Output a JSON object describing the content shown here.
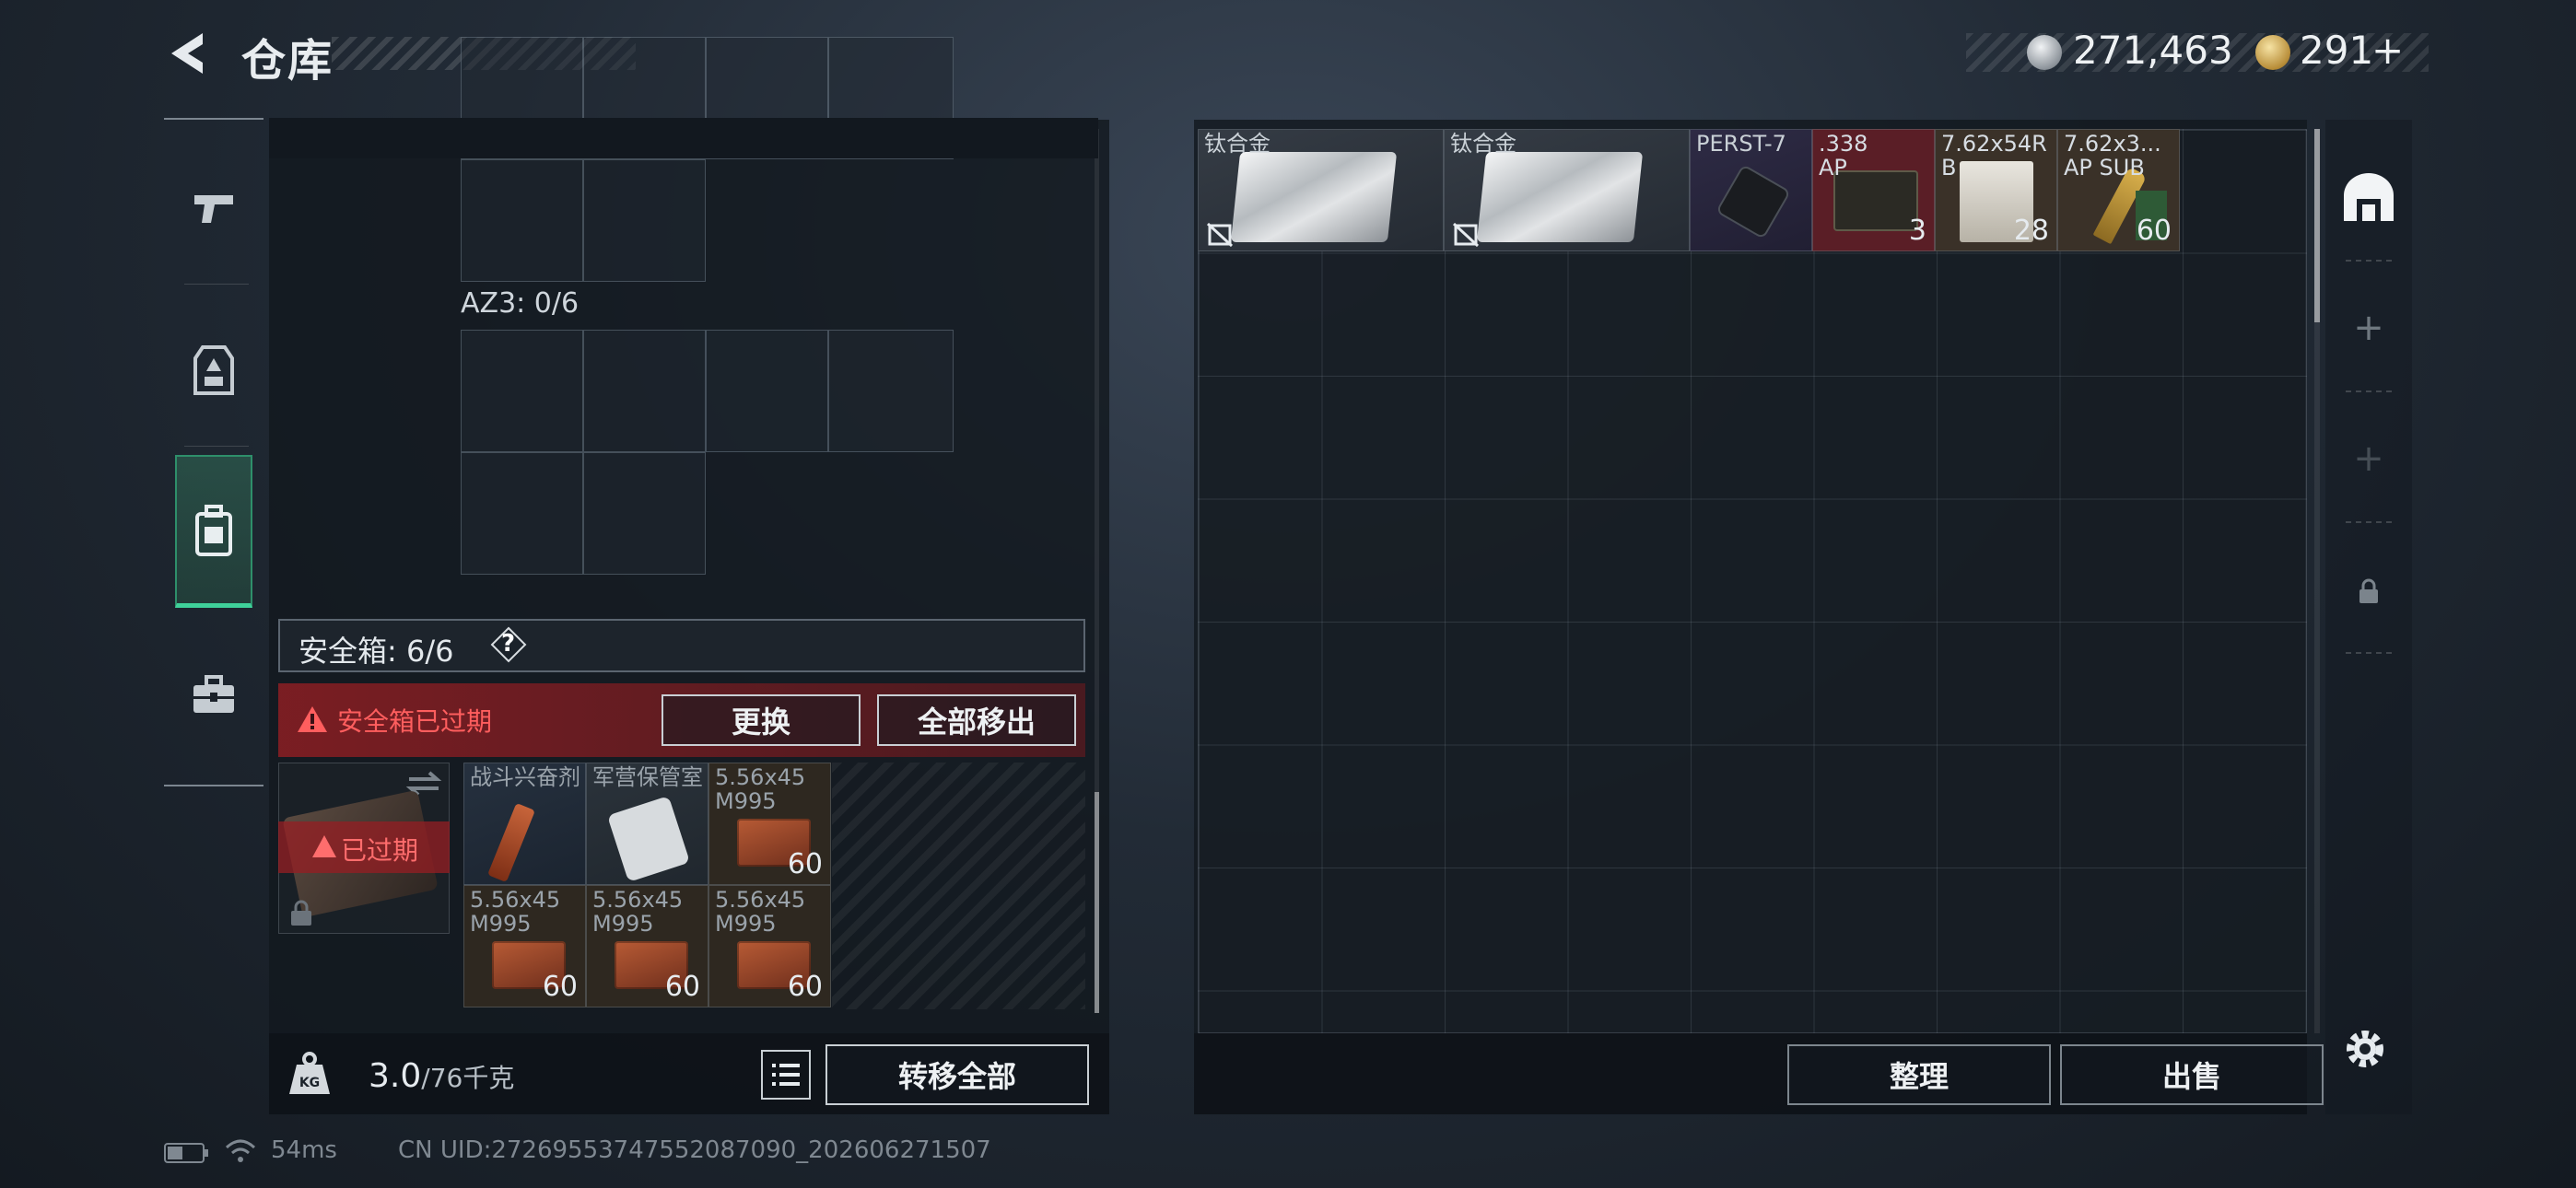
{
  "header": {
    "title": "仓库"
  },
  "currency": {
    "silver": "271,463",
    "gold": "291",
    "gold_add": "+"
  },
  "left_panel": {
    "az3_label": "AZ3: 0/6",
    "safe_box_label": "安全箱: 6/6",
    "help": "?",
    "warning": "安全箱已过期",
    "replace_button": "更换",
    "remove_all_button": "全部移出",
    "expired_label": "已过期",
    "safe_items": [
      {
        "name": "战斗兴奋剂",
        "count": ""
      },
      {
        "name": "军营保管室",
        "count": ""
      },
      {
        "name": "5.56x45\nM995",
        "count": "60"
      },
      {
        "name": "5.56x45\nM995",
        "count": "60"
      },
      {
        "name": "5.56x45\nM995",
        "count": "60"
      },
      {
        "name": "5.56x45\nM995",
        "count": "60"
      }
    ],
    "weight_value": "3.0",
    "weight_max": "/76千克",
    "transfer_all_button": "转移全部"
  },
  "stash_items": [
    {
      "name": "钛合金",
      "count": ""
    },
    {
      "name": "钛合金",
      "count": ""
    },
    {
      "name": "PERST-7",
      "count": ""
    },
    {
      "name": ".338\nAP",
      "count": "3"
    },
    {
      "name": "7.62x54R\nB",
      "count": "28"
    },
    {
      "name": "7.62x3...\nAP SUB",
      "count": "60"
    }
  ],
  "right_panel": {
    "sort_button": "整理",
    "sell_button": "出售"
  },
  "footer": {
    "ping": "54ms",
    "uid": "CN UID:27269553747552087090_202606271507"
  },
  "colors": {
    "accent_green": "#3fd19a",
    "warning_red": "#ff5e5e",
    "ammo_338_bg": "#5a1e26"
  }
}
